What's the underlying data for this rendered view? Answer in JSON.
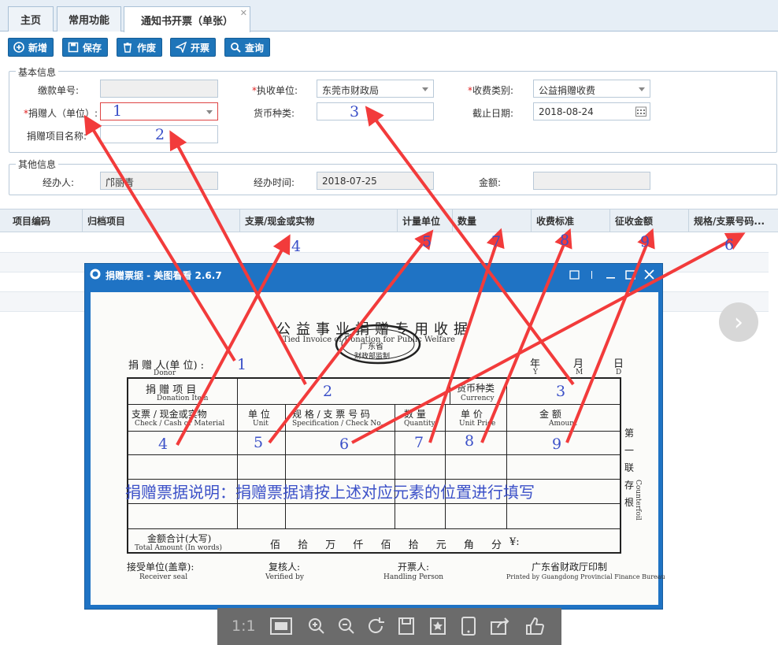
{
  "tabs": [
    "主页",
    "常用功能",
    "通知书开票（单张）"
  ],
  "tab_close": "✕",
  "toolbar": {
    "add": "新增",
    "save": "保存",
    "void": "作废",
    "issue": "开票",
    "query": "查询"
  },
  "basic": {
    "legend": "基本信息",
    "payment_no_label": "缴款单号:",
    "collector_label": "执收单位:",
    "collector_value": "东莞市财政局",
    "fee_type_label": "收费类别:",
    "fee_type_value": "公益捐赠收费",
    "donor_label": "捐赠人（单位）:",
    "currency_label": "货币种类:",
    "deadline_label": "截止日期:",
    "deadline_value": "2018-08-24",
    "project_label": "捐赠项目名称:"
  },
  "other": {
    "legend": "其他信息",
    "handler_label": "经办人:",
    "handler_value": "邝丽青",
    "handle_time_label": "经办时间:",
    "handle_time_value": "2018-07-25",
    "amount_label": "金额:"
  },
  "grid_columns": [
    "项目编码",
    "归档项目",
    "支票/现金或实物",
    "计量单位",
    "数量",
    "收费标准",
    "征收金额",
    "规格/支票号码..."
  ],
  "overlay_numbers": {
    "n1": "1",
    "n2": "2",
    "n3": "3",
    "n4": "4",
    "n5": "5",
    "n6": "6",
    "n7": "7",
    "n8": "8",
    "n9": "9"
  },
  "viewer": {
    "title": "捐赠票据 - 美图看看 2.6.7"
  },
  "receipt": {
    "title": "公益事业捐赠专用收据",
    "title_en": "Tied Invoice of Donation for Public Welfare",
    "province": "广东省",
    "seal": "财政部监制",
    "donor": "捐 赠 人(单 位) :",
    "donor_en": "Donor",
    "year": "年",
    "month": "月",
    "day": "日",
    "year_en": "Y",
    "month_en": "M",
    "day_en": "D",
    "item": "捐 赠 项 目",
    "item_en": "Donation Item",
    "currency": "货币种类",
    "currency_en": "Currency",
    "check": "支票 / 现金或实物",
    "check_en": "Check / Cash or Material",
    "unit": "单 位",
    "unit_en": "Unit",
    "spec": "规 格 / 支 票 号 码",
    "spec_en": "Specification / Check No.",
    "qty": "数 量",
    "qty_en": "Quantity",
    "price": "单 价",
    "price_en": "Unit Price",
    "amount": "金 额",
    "amount_en": "Amount",
    "stub": "第一联存根",
    "stub_en": "Counterfoil",
    "note": "捐赠票据说明：捐赠票据请按上述对应元素的位置进行填写",
    "total": "金额合计(大写)",
    "total_en": "Total Amount (In words)",
    "total_units": "佰 拾 万 仟 佰 拾 元 角 分",
    "yen": "¥:",
    "receiver": "接受单位(盖章):",
    "receiver_en": "Receiver seal",
    "verifier": "复核人:",
    "verifier_en": "Verified by",
    "handler": "开票人:",
    "handler_en": "Handling Person",
    "printer": "广东省财政厅印制",
    "printer_en": "Printed by Guangdong Provincial Finance Bureau"
  },
  "viewer_bar": {
    "ratio": "1:1"
  },
  "colors": {
    "primary": "#1e75b9",
    "arrow": "#f23b3b",
    "annotation": "#3b50c8",
    "viewer_title": "#1f73c4"
  }
}
